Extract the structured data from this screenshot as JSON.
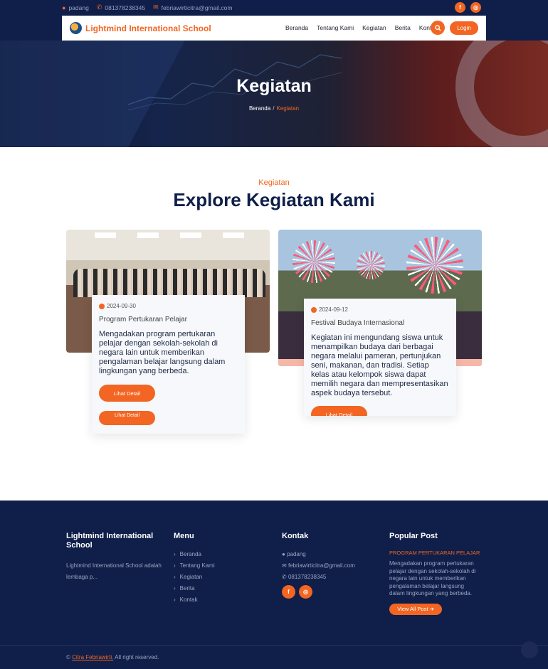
{
  "topbar": {
    "location": "padang",
    "phone": "081378238345",
    "email": "febriawirticitra@gmail.com",
    "social": [
      "f",
      "◎"
    ]
  },
  "navbar": {
    "brand": "Lightmind International School",
    "menu": [
      "Beranda",
      "Tentang Kami",
      "Kegiatan",
      "Berita",
      "Kontak"
    ],
    "login": "Login"
  },
  "hero": {
    "title": "Kegiatan",
    "breadcrumb_home": "Beranda",
    "breadcrumb_sep": "/",
    "breadcrumb_current": "Kegiatan"
  },
  "section": {
    "subtitle": "Kegiatan",
    "title": "Explore Kegiatan Kami"
  },
  "cards": [
    {
      "date": "2024-09-30",
      "title": "Program Pertukaran Pelajar",
      "desc": "Mengadakan program pertukaran pelajar dengan sekolah-sekolah di negara lain untuk memberikan pengalaman belajar langsung dalam lingkungan yang berbeda.",
      "button": "Lihat Detail"
    },
    {
      "date": "2024-09-12",
      "title": "Festival Budaya Internasional",
      "desc": "Kegiatan ini mengundang siswa untuk menampilkan budaya dari berbagai negara melalui pameran, pertunjukan seni, makanan, dan tradisi. Setiap kelas atau kelompok siswa dapat memilih negara dan mempresentasikan aspek budaya tersebut.",
      "button": "Lihat Detail"
    }
  ],
  "footer": {
    "about_title": "Lightmind International School",
    "about_text": "Lightmind International School adalah lembaga p...",
    "menu_title": "Menu",
    "menu": [
      "Beranda",
      "Tentang Kami",
      "Kegiatan",
      "Berita",
      "Kontak"
    ],
    "contact_title": "Kontak",
    "contact_location": "padang",
    "contact_email": "febriawirticitra@gmail.com",
    "contact_phone": "081378238345",
    "popular_title": "Popular Post",
    "popular_post_title": "PROGRAM PERTUKARAN PELAJAR",
    "popular_post_desc": "Mengadakan program pertukaran pelajar dengan sekolah-sekolah di negara lain untuk memberikan pengalaman belajar langsung dalam lingkungan yang berbeda.",
    "view_all": "View All Post",
    "copyright_name": "Citra Febriawirti.",
    "copyright_text": "All right reserved."
  },
  "colors": {
    "accent": "#f26522",
    "navy": "#0f1f4a"
  }
}
